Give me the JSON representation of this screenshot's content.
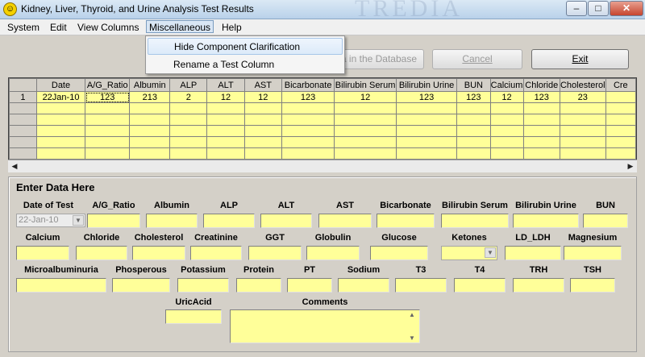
{
  "window": {
    "title": "Kidney, Liver, Thyroid, and Urine Analysis Test Results",
    "watermark": "TREDIA",
    "minimize": "–",
    "restore": "□",
    "close": "✕"
  },
  "menu": {
    "system": "System",
    "edit": "Edit",
    "view_columns": "View Columns",
    "miscellaneous": "Miscellaneous",
    "help": "Help"
  },
  "dropdown": {
    "hide_component": "Hide Component Clarification",
    "rename_column": "Rename a Test Column"
  },
  "toolbar": {
    "save_partial": "ta in the Database",
    "cancel": "Cancel",
    "exit": "Exit"
  },
  "grid": {
    "headers": [
      "",
      "Date",
      "A/G_Ratio",
      "Albumin",
      "ALP",
      "ALT",
      "AST",
      "Bicarbonate",
      "Bilirubin Serum",
      "Bilirubin Urine",
      "BUN",
      "Calcium",
      "Chloride",
      "Cholesterol",
      "Cre"
    ],
    "row1": [
      "1",
      "22Jan-10",
      "123",
      "213",
      "2",
      "12",
      "12",
      "123",
      "12",
      "123",
      "123",
      "12",
      "123",
      "23",
      ""
    ]
  },
  "form": {
    "section_title": "Enter Data Here",
    "date_of_test_label": "Date of Test",
    "date_value": "22-Jan-10",
    "row1_labels": [
      "A/G_Ratio",
      "Albumin",
      "ALP",
      "ALT",
      "AST",
      "Bicarbonate",
      "Bilirubin Serum",
      "Bilirubin Urine",
      "BUN"
    ],
    "row2_labels": [
      "Calcium",
      "Chloride",
      "Cholesterol",
      "Creatinine",
      "GGT",
      "Globulin",
      "Glucose",
      "Ketones",
      "LD_LDH",
      "Magnesium"
    ],
    "row3_labels": [
      "Microalbuminuria",
      "Phosperous",
      "Potassium",
      "Protein",
      "PT",
      "Sodium",
      "T3",
      "T4",
      "TRH",
      "TSH"
    ],
    "uric_acid_label": "UricAcid",
    "comments_label": "Comments"
  },
  "colors": {
    "field_yellow": "#ffff99",
    "window_gray": "#d4d0c8"
  }
}
